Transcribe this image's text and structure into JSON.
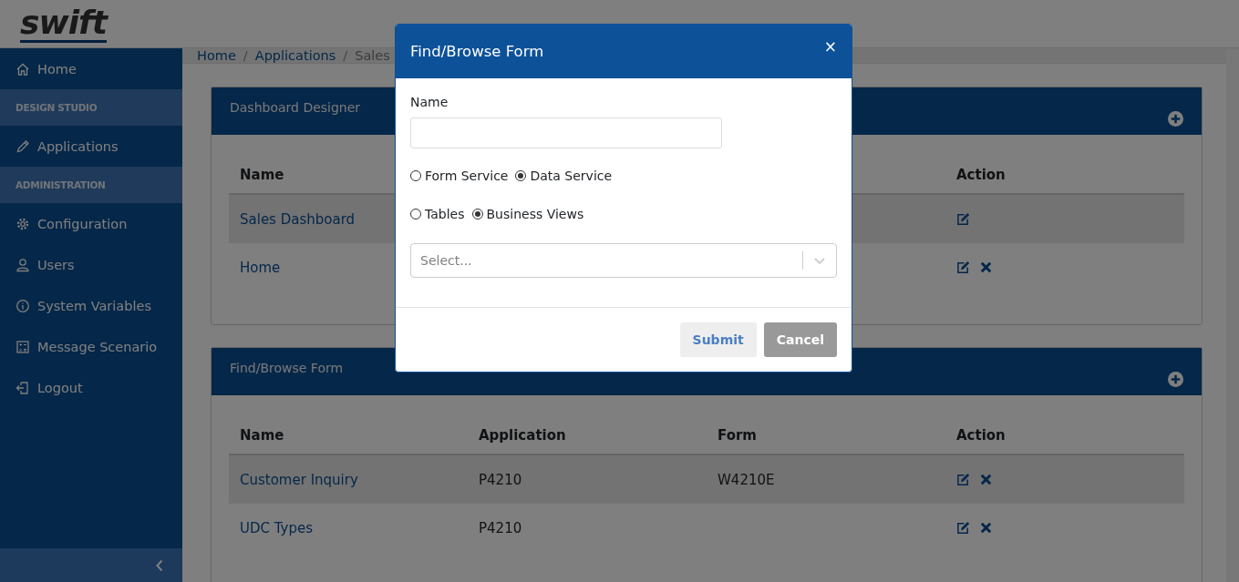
{
  "logo": "swift",
  "sidebar": {
    "items": [
      {
        "kind": "link",
        "label": "Home"
      },
      {
        "kind": "section",
        "label": "DESIGN STUDIO"
      },
      {
        "kind": "link",
        "label": "Applications"
      },
      {
        "kind": "section",
        "label": "ADMINISTRATION"
      },
      {
        "kind": "link",
        "label": "Configuration"
      },
      {
        "kind": "link",
        "label": "Users"
      },
      {
        "kind": "link",
        "label": "System Variables"
      },
      {
        "kind": "link",
        "label": "Message Scenario"
      },
      {
        "kind": "link",
        "label": "Logout"
      }
    ]
  },
  "breadcrumb": {
    "separator": "/",
    "items": [
      "Home",
      "Applications",
      "Sales"
    ]
  },
  "panels": [
    {
      "title": "Dashboard Designer",
      "columns": {
        "name": "Name",
        "action": "Action"
      },
      "rows": [
        {
          "name": "Sales Dashboard",
          "deletable": false
        },
        {
          "name": "Home",
          "deletable": true
        }
      ]
    },
    {
      "title": "Find/Browse Form",
      "columns": {
        "name": "Name",
        "application": "Application",
        "form": "Form",
        "action": "Action"
      },
      "rows": [
        {
          "name": "Customer Inquiry",
          "application": "P4210",
          "form": "W4210E",
          "deletable": true
        },
        {
          "name": "UDC Types",
          "application": "P4210",
          "deletable": true
        }
      ]
    }
  ],
  "modal": {
    "title": "Find/Browse Form",
    "close": "×",
    "name_label": "Name",
    "radio_groups": [
      {
        "options": [
          {
            "label": "Form Service",
            "selected": false
          },
          {
            "label": "Data Service",
            "selected": true
          }
        ]
      },
      {
        "options": [
          {
            "label": "Tables",
            "selected": false
          },
          {
            "label": "Business Views",
            "selected": true
          }
        ]
      }
    ],
    "select": {
      "placeholder": "Select..."
    },
    "buttons": [
      {
        "label": "Submit",
        "kind": "light"
      },
      {
        "label": "Cancel",
        "kind": "secondary"
      }
    ]
  }
}
